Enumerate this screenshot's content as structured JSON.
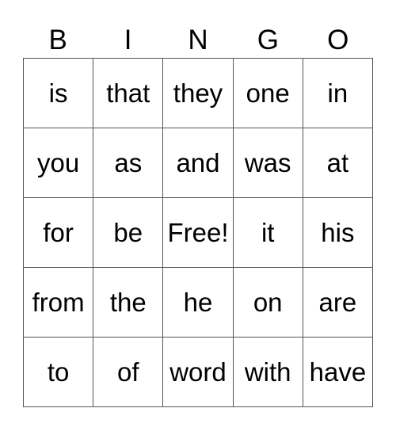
{
  "header": [
    "B",
    "I",
    "N",
    "G",
    "O"
  ],
  "cells": [
    [
      "is",
      "that",
      "they",
      "one",
      "in"
    ],
    [
      "you",
      "as",
      "and",
      "was",
      "at"
    ],
    [
      "for",
      "be",
      "Free!",
      "it",
      "his"
    ],
    [
      "from",
      "the",
      "he",
      "on",
      "are"
    ],
    [
      "to",
      "of",
      "word",
      "with",
      "have"
    ]
  ]
}
